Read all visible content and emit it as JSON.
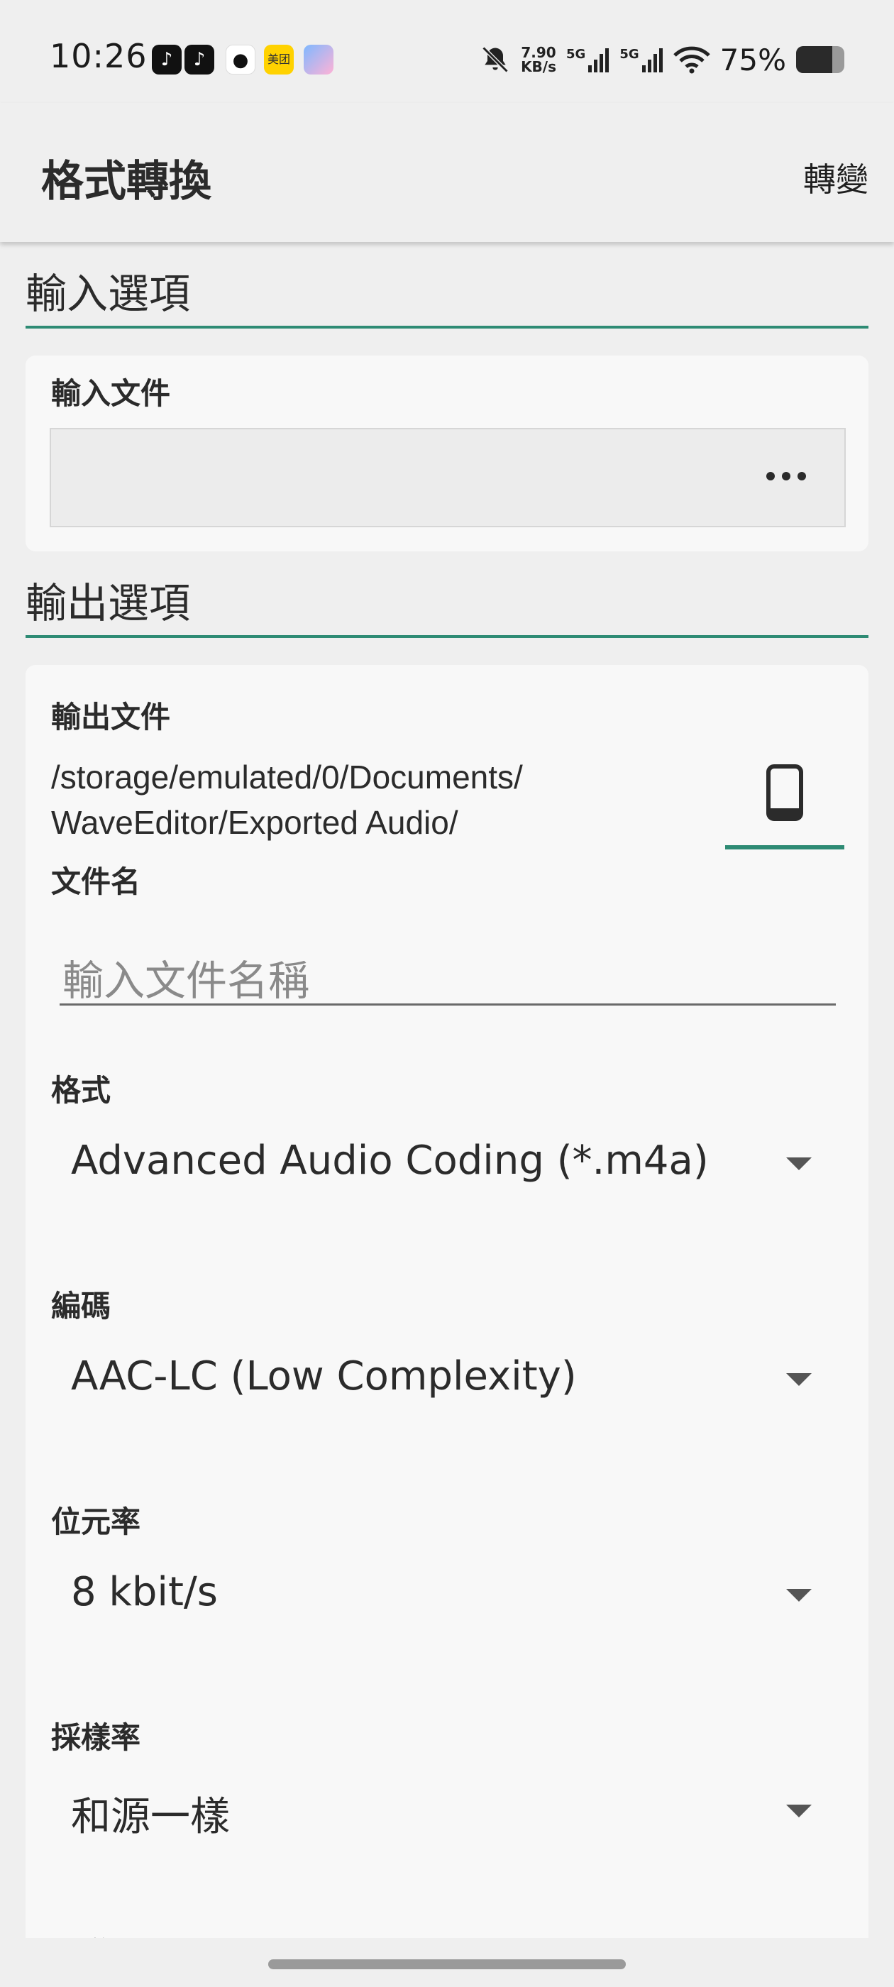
{
  "status_bar": {
    "time": "10:26",
    "net_speed_value": "7.90",
    "net_speed_unit": "KB/s",
    "signal_1": "5G",
    "signal_2": "5G",
    "battery_pct": "75%",
    "battery_level": 0.75,
    "apps": [
      "tiktok-icon",
      "tiktok-icon",
      "qq-icon",
      "meituan-icon",
      "bubble-app-icon"
    ],
    "meituan_label": "美团"
  },
  "app_bar": {
    "title": "格式轉換",
    "action": "轉變"
  },
  "input_section": {
    "header": "輸入選項",
    "file_label": "輸入文件",
    "file_value": ""
  },
  "output_section": {
    "header": "輸出選項",
    "file_label": "輸出文件",
    "path_line1": "/storage/emulated/0/Documents/",
    "path_line2": "WaveEditor/Exported Audio/",
    "filename_label": "文件名",
    "filename_placeholder": "輸入文件名稱",
    "format_label": "格式",
    "format_value": "Advanced Audio Coding (*.m4a)",
    "codec_label": "編碼",
    "codec_value": "AAC-LC (Low Complexity)",
    "bitrate_label": "位元率",
    "bitrate_value": "8 kbit/s",
    "samplerate_label": "採樣率",
    "samplerate_value": "和源一樣",
    "channels_label": "通道"
  },
  "colors": {
    "accent": "#2e8b74",
    "background": "#efefef",
    "card": "#f8f8f8"
  }
}
